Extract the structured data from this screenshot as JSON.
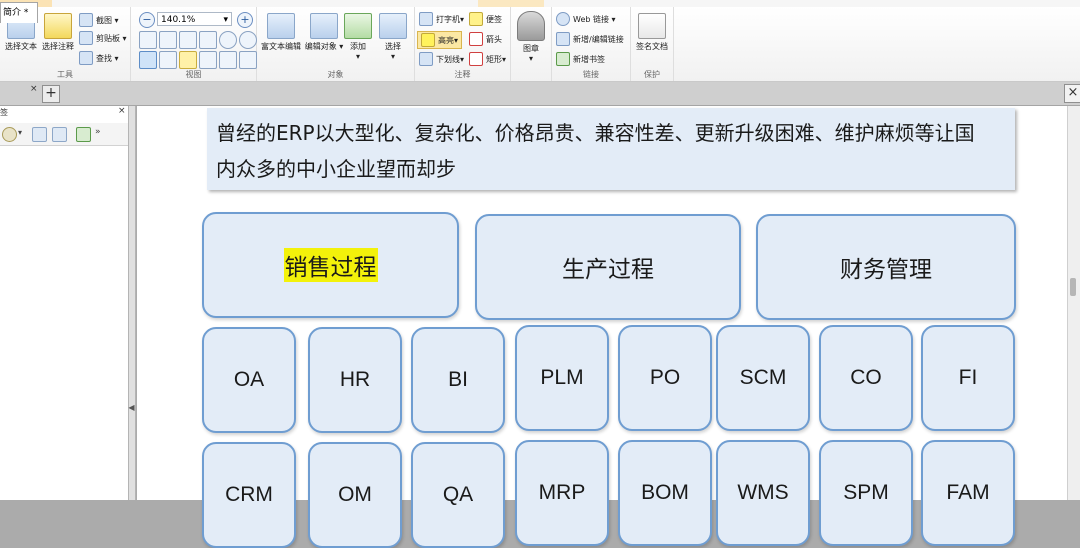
{
  "ribbon": {
    "tools_group": {
      "label": "工具",
      "select_text": "选择文本",
      "select_annotation": "选择注释",
      "screenshot": "截图",
      "clipboard": "剪贴板",
      "find": "查找"
    },
    "view_group": {
      "label": "视图",
      "zoom_value": "140.1%"
    },
    "object_group": {
      "label": "对象",
      "rich_text_edit": "富文本编辑",
      "edit_object": "编辑对象",
      "add": "添加",
      "select": "选择"
    },
    "comment_group": {
      "label": "注释",
      "typewriter": "打字机",
      "note": "便签",
      "highlight": "高亮",
      "arrow": "箭头",
      "underline": "下划线",
      "rectangle": "矩形"
    },
    "stamp_group": {
      "stamp": "图章"
    },
    "link_group": {
      "label": "链接",
      "web_link": "Web 链接",
      "new_edit_link": "新增/编辑链接",
      "new_bookmark": "新增书签"
    },
    "protect_group": {
      "label": "保护",
      "sign_document": "签名文档"
    }
  },
  "tabs": {
    "document_tab": "简介 *",
    "close": "×",
    "new_tab": "+",
    "window_close": "×"
  },
  "sidebar": {
    "title": "签",
    "close": "×"
  },
  "document": {
    "text_line1": "曾经的ERP以大型化、复杂化、价格昂贵、兼容性差、更新升级困难、维护麻烦等让国",
    "text_line2": "内众多的中小企业望而却步",
    "categories": [
      "销售过程",
      "生产过程",
      "财务管理"
    ],
    "row1": [
      "OA",
      "HR",
      "BI",
      "PLM",
      "PO",
      "SCM",
      "CO",
      "FI"
    ],
    "row2": [
      "CRM",
      "OM",
      "QA",
      "MRP",
      "BOM",
      "WMS",
      "SPM",
      "FAM"
    ]
  }
}
